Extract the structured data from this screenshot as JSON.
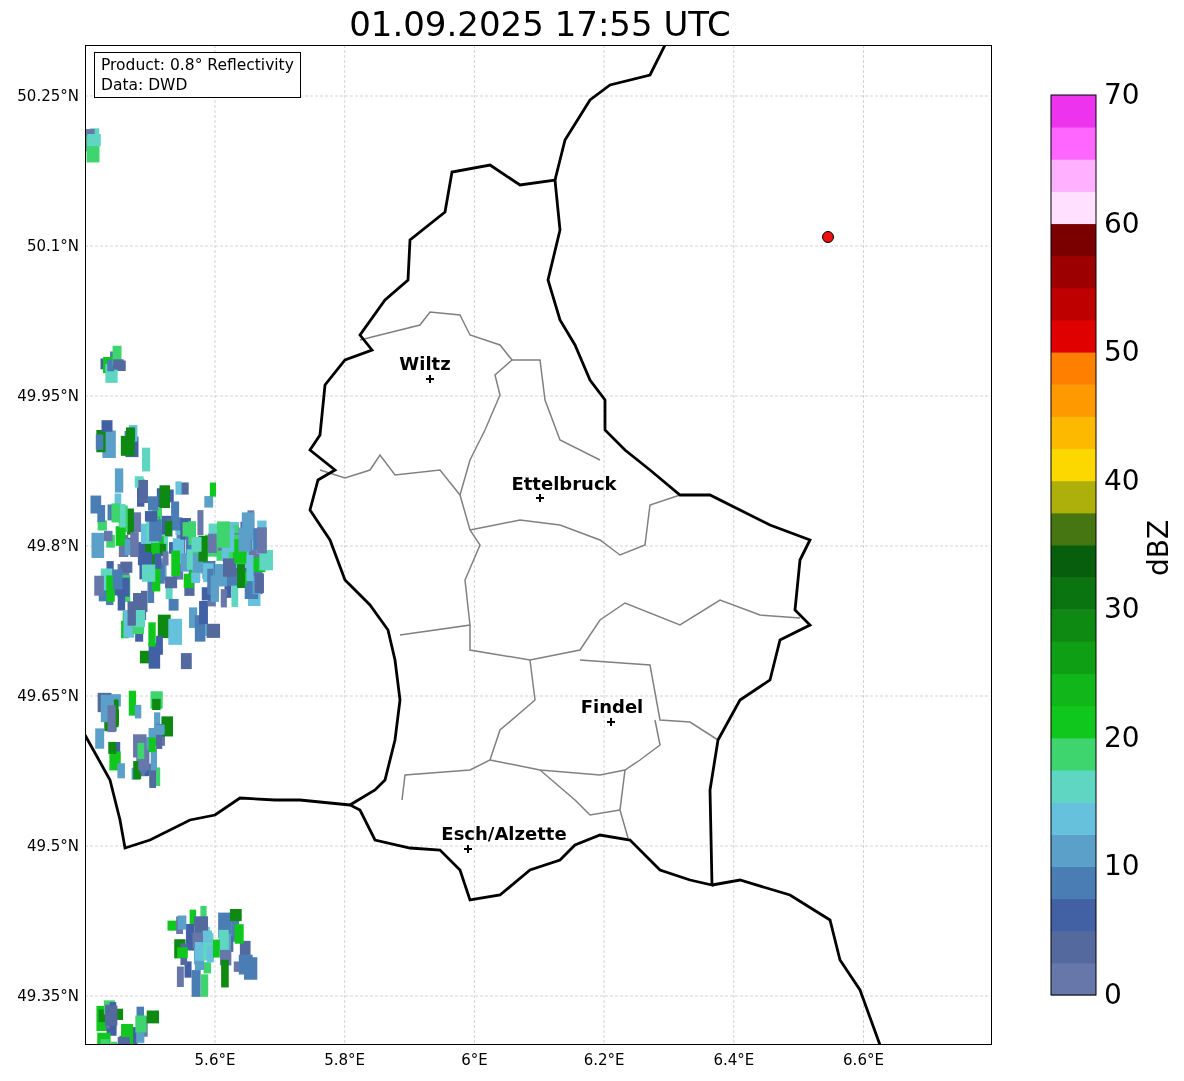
{
  "title": "01.09.2025 17:55 UTC",
  "info_box": [
    "Product: 0.8° Reflectivity",
    "Data: DWD"
  ],
  "lat_ticks": [
    "50.25°N",
    "50.1°N",
    "49.95°N",
    "49.8°N",
    "49.65°N",
    "49.5°N",
    "49.35°N"
  ],
  "lon_ticks": [
    "5.6°E",
    "5.8°E",
    "6°E",
    "6.2°E",
    "6.4°E",
    "6.6°E"
  ],
  "places": [
    {
      "name": "Wiltz"
    },
    {
      "name": "Ettelbruck"
    },
    {
      "name": "Findel"
    },
    {
      "name": "Esch/Alzette"
    }
  ],
  "colorbar": {
    "label": "dBZ",
    "ticks": [
      "70",
      "60",
      "50",
      "40",
      "30",
      "20",
      "10",
      "0"
    ],
    "bins": [
      {
        "color": "#6777a9"
      },
      {
        "color": "#546a9f"
      },
      {
        "color": "#4260a4"
      },
      {
        "color": "#4b7db5"
      },
      {
        "color": "#5ba0c8"
      },
      {
        "color": "#66c2dc"
      },
      {
        "color": "#5fd6c2"
      },
      {
        "color": "#3ed46e"
      },
      {
        "color": "#10c81d"
      },
      {
        "color": "#10b61a"
      },
      {
        "color": "#0f9f14"
      },
      {
        "color": "#0e8a12"
      },
      {
        "color": "#0a7510"
      },
      {
        "color": "#075e0c"
      },
      {
        "color": "#467612"
      },
      {
        "color": "#adb00a"
      },
      {
        "color": "#fdd800"
      },
      {
        "color": "#fdb800"
      },
      {
        "color": "#ff9900"
      },
      {
        "color": "#ff7f00"
      },
      {
        "color": "#e00000"
      },
      {
        "color": "#bf0000"
      },
      {
        "color": "#9d0000"
      },
      {
        "color": "#7a0000"
      },
      {
        "color": "#ffe0ff"
      },
      {
        "color": "#ffb0ff"
      },
      {
        "color": "#ff66ff"
      },
      {
        "color": "#ee33ee"
      }
    ]
  }
}
